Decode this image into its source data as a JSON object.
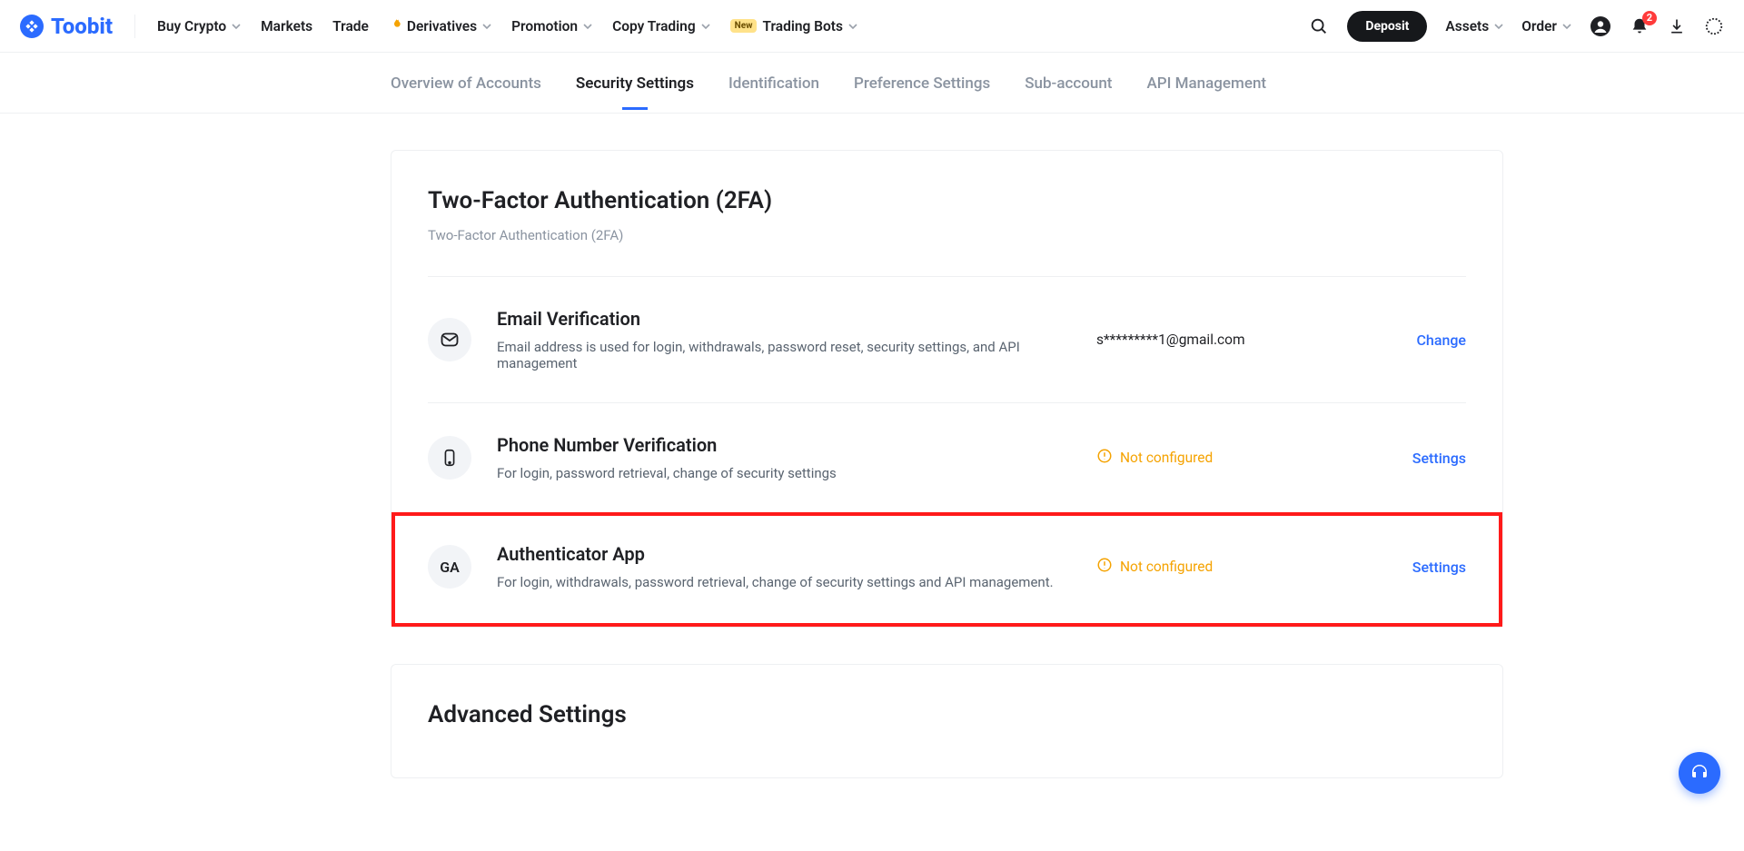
{
  "brand": {
    "name": "Toobit"
  },
  "nav": {
    "items": [
      {
        "label": "Buy Crypto",
        "caret": true
      },
      {
        "label": "Markets",
        "caret": false
      },
      {
        "label": "Trade",
        "caret": false
      },
      {
        "label": "Derivatives",
        "caret": true,
        "flame": true
      },
      {
        "label": "Promotion",
        "caret": true
      },
      {
        "label": "Copy Trading",
        "caret": true
      },
      {
        "label": "Trading Bots",
        "caret": true,
        "pill": "New"
      }
    ],
    "deposit": "Deposit",
    "assets": {
      "label": "Assets"
    },
    "order": {
      "label": "Order"
    },
    "notif_badge": "2"
  },
  "subnav": {
    "items": [
      {
        "label": "Overview of Accounts"
      },
      {
        "label": "Security Settings",
        "active": true
      },
      {
        "label": "Identification"
      },
      {
        "label": "Preference Settings"
      },
      {
        "label": "Sub-account"
      },
      {
        "label": "API Management"
      }
    ]
  },
  "twofa": {
    "title": "Two-Factor Authentication (2FA)",
    "subtitle": "Two-Factor Authentication (2FA)",
    "email": {
      "title": "Email Verification",
      "desc": "Email address is used for login, withdrawals, password reset, security settings, and API management",
      "value": "s*********1@gmail.com",
      "action": "Change"
    },
    "phone": {
      "title": "Phone Number Verification",
      "desc": "For login, password retrieval, change of security settings",
      "status": "Not configured",
      "action": "Settings"
    },
    "auth": {
      "icon_label": "GA",
      "title": "Authenticator App",
      "desc": "For login, withdrawals, password retrieval, change of security settings and API management.",
      "status": "Not configured",
      "action": "Settings"
    }
  },
  "advanced": {
    "title": "Advanced Settings"
  }
}
